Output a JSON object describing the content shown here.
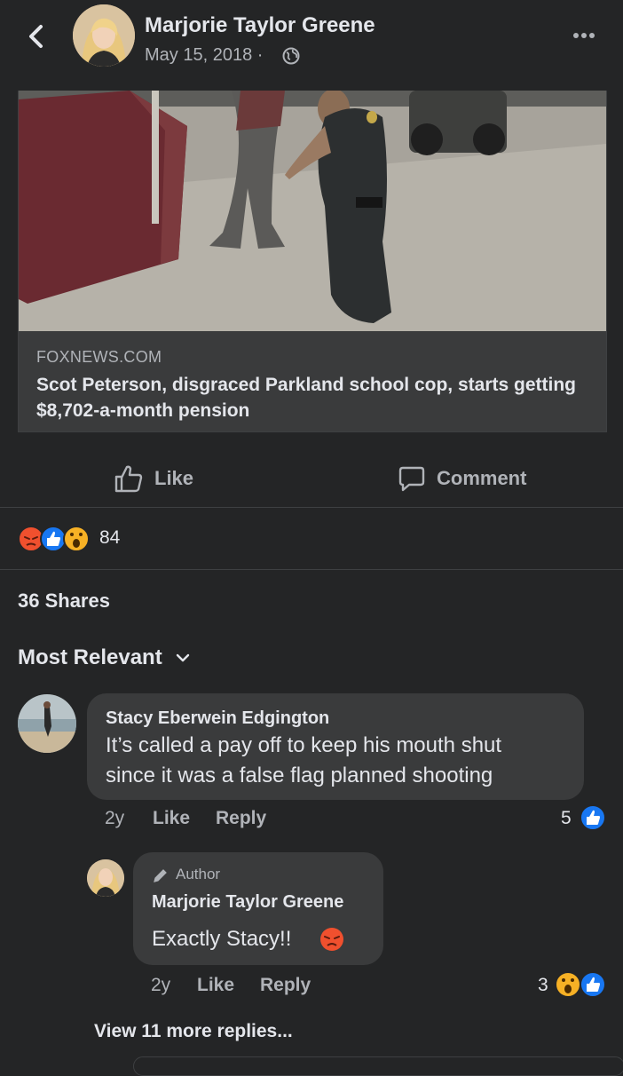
{
  "header": {
    "author": "Marjorie Taylor Greene",
    "date": "May 15, 2018 ·",
    "privacy_icon": "globe-icon"
  },
  "link_card": {
    "domain": "FOXNEWS.COM",
    "title": "Scot Peterson, disgraced Parkland school cop, starts getting $8,702-a-month pension"
  },
  "actions": {
    "like": "Like",
    "comment": "Comment"
  },
  "reactions": {
    "types": [
      "angry",
      "like",
      "wow"
    ],
    "count": "84"
  },
  "shares": "36 Shares",
  "sort": {
    "label": "Most Relevant"
  },
  "comments": [
    {
      "name": "Stacy Eberwein Edgington",
      "text_line1": "It’s called a pay off to keep his mouth shut",
      "text_line2": "since it was a false flag planned shooting",
      "age": "2y",
      "like": "Like",
      "reply": "Reply",
      "reaction_count": "5",
      "reaction_types": [
        "like"
      ]
    }
  ],
  "reply": {
    "badge": "Author",
    "name": "Marjorie Taylor Greene",
    "text": "Exactly Stacy!!",
    "emoji": "angry",
    "age": "2y",
    "like": "Like",
    "reply": "Reply",
    "reaction_count": "3",
    "reaction_types": [
      "wow",
      "like"
    ]
  },
  "view_more": "View 11 more replies...",
  "colors": {
    "background": "#242526",
    "bubble": "#3a3b3c",
    "text_primary": "#e4e6eb",
    "text_secondary": "#b0b3b8",
    "like_blue": "#1877f2",
    "angry_orange": "#f0502e",
    "wow_yellow": "#f7b125"
  }
}
